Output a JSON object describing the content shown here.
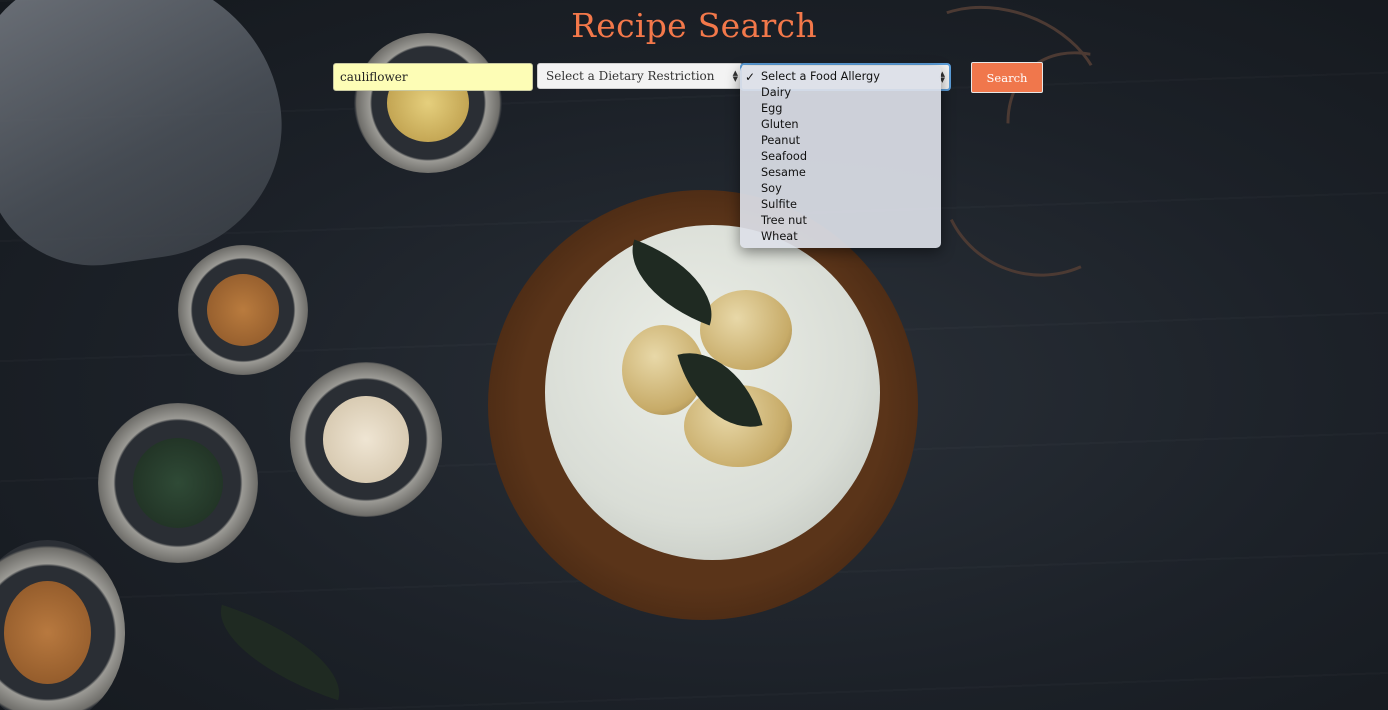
{
  "page": {
    "title": "Recipe Search"
  },
  "search": {
    "value": "cauliflower"
  },
  "dietary_select": {
    "selected": "Select a Dietary Restriction"
  },
  "allergy_select": {
    "selected": "Select a Food Allergy",
    "options": [
      "Select a Food Allergy",
      "Dairy",
      "Egg",
      "Gluten",
      "Peanut",
      "Seafood",
      "Sesame",
      "Soy",
      "Sulfite",
      "Tree nut",
      "Wheat"
    ]
  },
  "search_button": {
    "label": "Search"
  },
  "icons": {
    "selected_option": "checkmark-icon",
    "select_arrows": "select-arrows-icon"
  },
  "colors": {
    "accent": "#f3784a",
    "input_bg": "#fdfdb6",
    "focus_ring": "#5b9dd9"
  }
}
